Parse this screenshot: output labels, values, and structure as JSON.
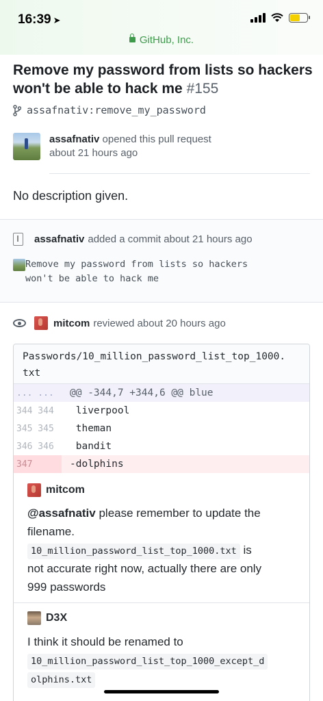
{
  "status_bar": {
    "time": "16:39",
    "time_arrow": "➤"
  },
  "browser": {
    "site_label": "GitHub, Inc."
  },
  "pull_request": {
    "title": "Remove my password from lists so hackers won't be able to hack me",
    "number": "#155",
    "branch": "assafnativ:remove_my_password",
    "author": "assafnativ",
    "opened_text": "opened this pull request",
    "opened_time": "about 21 hours ago",
    "description": "No description given."
  },
  "commit_event": {
    "author": "assafnativ",
    "action": "added a commit about 21 hours ago",
    "message_line1": "Remove my password from lists so hackers",
    "message_line2": "won't be able to hack me"
  },
  "review_event": {
    "author": "mitcom",
    "action": "reviewed about 20 hours ago"
  },
  "diff": {
    "file_line1": "Passwords/10_million_password_list_top_1000.",
    "file_line2": "txt",
    "hunk_ln": "... ...",
    "hunk_header": "@@ -344,7 +344,6 @@ blue",
    "lines": [
      {
        "ln": "344 344",
        "code": " liverpool"
      },
      {
        "ln": "345 345",
        "code": " theman"
      },
      {
        "ln": "346 346",
        "code": " bandit"
      },
      {
        "ln": "347",
        "code": "-dolphins"
      }
    ]
  },
  "comments": [
    {
      "author": "mitcom",
      "mention": "@assafnativ",
      "text1": " please remember to update the",
      "text2": "filename.",
      "code": "10_million_password_list_top_1000.txt",
      "text3": " is",
      "text4": "not accurate right now, actually there are only",
      "text5": "999 passwords"
    },
    {
      "author": "D3X",
      "text1": "I think it should be renamed to",
      "code1": "10_million_password_list_top_1000_except_d",
      "code2": "olphins.txt"
    }
  ]
}
